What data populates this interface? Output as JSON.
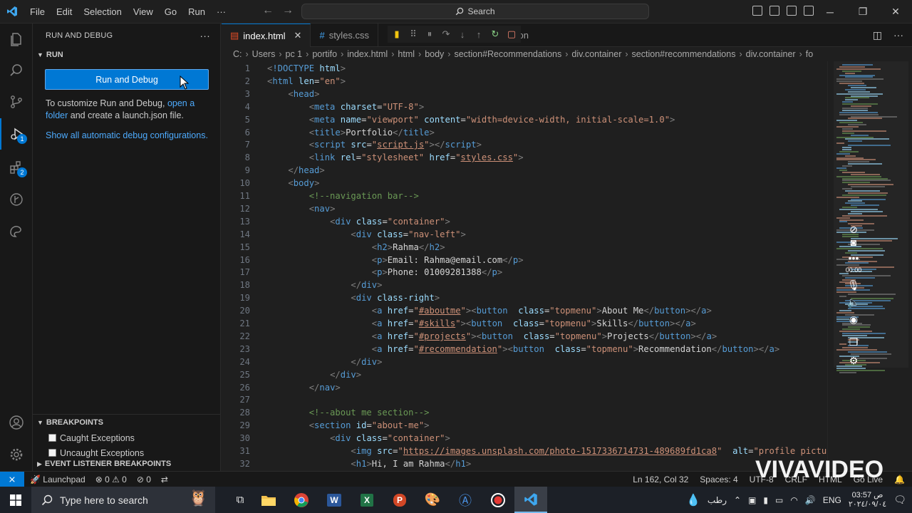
{
  "titlebar": {
    "menu": [
      "File",
      "Edit",
      "Selection",
      "View",
      "Go",
      "Run",
      "···"
    ],
    "search_placeholder": "Search"
  },
  "activity": {
    "debug_badge": "1",
    "extensions_badge": "2"
  },
  "sidebar": {
    "title": "RUN AND DEBUG",
    "run_section": "RUN",
    "run_button": "Run and Debug",
    "desc_prefix": "To customize Run and Debug, ",
    "desc_link": "open a folder",
    "desc_suffix": " and create a launch.json file.",
    "show_all": "Show all automatic debug configurations.",
    "breakpoints_title": "BREAKPOINTS",
    "breakpoints": [
      {
        "label": "Caught Exceptions",
        "checked": false
      },
      {
        "label": "Uncaught Exceptions",
        "checked": false
      }
    ],
    "event_listener": "EVENT LISTENER BREAKPOINTS"
  },
  "tabs": [
    {
      "label": "index.html",
      "active": true
    },
    {
      "label": "styles.css",
      "active": false
    },
    {
      "label": "son",
      "active": false
    }
  ],
  "breadcrumb": [
    "C:",
    "Users",
    "pc 1",
    "portifo",
    "index.html",
    "html",
    "body",
    "section#Recommendations",
    "div.container",
    "section#recommendations",
    "div.container",
    "fo"
  ],
  "statusbar": {
    "launchpad": "Launchpad",
    "problems": "⊗ 0 ⚠ 0",
    "ports": "⊘ 0",
    "position": "Ln 162, Col 32",
    "spaces": "Spaces: 4",
    "encoding": "UTF-8",
    "eol": "CRLF",
    "language": "HTML",
    "golive": "Go Live"
  },
  "watermark": "VIVAVIDEO",
  "recorder": {
    "time": "00:00"
  },
  "taskbar": {
    "search_placeholder": "Type here to search",
    "weather": "رطب",
    "lang": "ENG",
    "time": "03:57 ص",
    "date": "٢٠٢٤/٠٩/٠٤"
  }
}
